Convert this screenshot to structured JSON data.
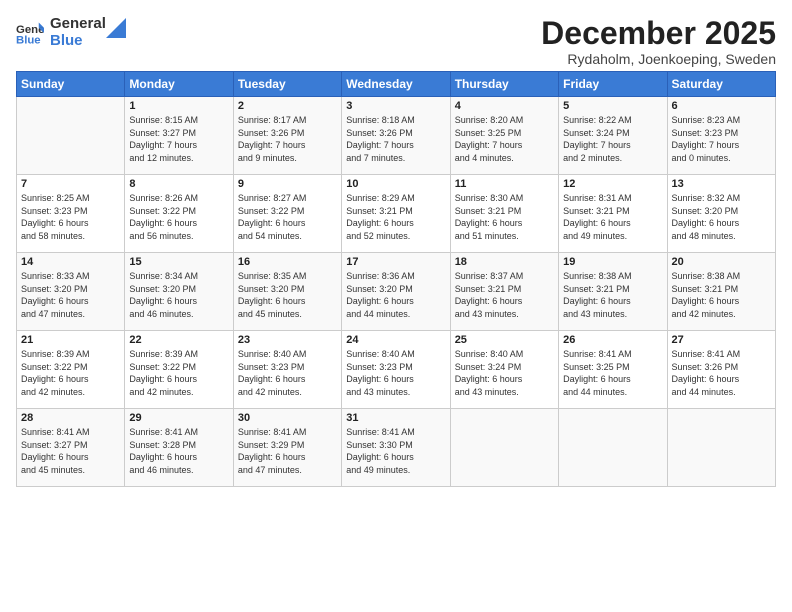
{
  "logo": {
    "general": "General",
    "blue": "Blue"
  },
  "title": "December 2025",
  "subtitle": "Rydaholm, Joenkoeping, Sweden",
  "days_of_week": [
    "Sunday",
    "Monday",
    "Tuesday",
    "Wednesday",
    "Thursday",
    "Friday",
    "Saturday"
  ],
  "weeks": [
    [
      {
        "day": "",
        "content": ""
      },
      {
        "day": "1",
        "content": "Sunrise: 8:15 AM\nSunset: 3:27 PM\nDaylight: 7 hours\nand 12 minutes."
      },
      {
        "day": "2",
        "content": "Sunrise: 8:17 AM\nSunset: 3:26 PM\nDaylight: 7 hours\nand 9 minutes."
      },
      {
        "day": "3",
        "content": "Sunrise: 8:18 AM\nSunset: 3:26 PM\nDaylight: 7 hours\nand 7 minutes."
      },
      {
        "day": "4",
        "content": "Sunrise: 8:20 AM\nSunset: 3:25 PM\nDaylight: 7 hours\nand 4 minutes."
      },
      {
        "day": "5",
        "content": "Sunrise: 8:22 AM\nSunset: 3:24 PM\nDaylight: 7 hours\nand 2 minutes."
      },
      {
        "day": "6",
        "content": "Sunrise: 8:23 AM\nSunset: 3:23 PM\nDaylight: 7 hours\nand 0 minutes."
      }
    ],
    [
      {
        "day": "7",
        "content": "Sunrise: 8:25 AM\nSunset: 3:23 PM\nDaylight: 6 hours\nand 58 minutes."
      },
      {
        "day": "8",
        "content": "Sunrise: 8:26 AM\nSunset: 3:22 PM\nDaylight: 6 hours\nand 56 minutes."
      },
      {
        "day": "9",
        "content": "Sunrise: 8:27 AM\nSunset: 3:22 PM\nDaylight: 6 hours\nand 54 minutes."
      },
      {
        "day": "10",
        "content": "Sunrise: 8:29 AM\nSunset: 3:21 PM\nDaylight: 6 hours\nand 52 minutes."
      },
      {
        "day": "11",
        "content": "Sunrise: 8:30 AM\nSunset: 3:21 PM\nDaylight: 6 hours\nand 51 minutes."
      },
      {
        "day": "12",
        "content": "Sunrise: 8:31 AM\nSunset: 3:21 PM\nDaylight: 6 hours\nand 49 minutes."
      },
      {
        "day": "13",
        "content": "Sunrise: 8:32 AM\nSunset: 3:20 PM\nDaylight: 6 hours\nand 48 minutes."
      }
    ],
    [
      {
        "day": "14",
        "content": "Sunrise: 8:33 AM\nSunset: 3:20 PM\nDaylight: 6 hours\nand 47 minutes."
      },
      {
        "day": "15",
        "content": "Sunrise: 8:34 AM\nSunset: 3:20 PM\nDaylight: 6 hours\nand 46 minutes."
      },
      {
        "day": "16",
        "content": "Sunrise: 8:35 AM\nSunset: 3:20 PM\nDaylight: 6 hours\nand 45 minutes."
      },
      {
        "day": "17",
        "content": "Sunrise: 8:36 AM\nSunset: 3:20 PM\nDaylight: 6 hours\nand 44 minutes."
      },
      {
        "day": "18",
        "content": "Sunrise: 8:37 AM\nSunset: 3:21 PM\nDaylight: 6 hours\nand 43 minutes."
      },
      {
        "day": "19",
        "content": "Sunrise: 8:38 AM\nSunset: 3:21 PM\nDaylight: 6 hours\nand 43 minutes."
      },
      {
        "day": "20",
        "content": "Sunrise: 8:38 AM\nSunset: 3:21 PM\nDaylight: 6 hours\nand 42 minutes."
      }
    ],
    [
      {
        "day": "21",
        "content": "Sunrise: 8:39 AM\nSunset: 3:22 PM\nDaylight: 6 hours\nand 42 minutes."
      },
      {
        "day": "22",
        "content": "Sunrise: 8:39 AM\nSunset: 3:22 PM\nDaylight: 6 hours\nand 42 minutes."
      },
      {
        "day": "23",
        "content": "Sunrise: 8:40 AM\nSunset: 3:23 PM\nDaylight: 6 hours\nand 42 minutes."
      },
      {
        "day": "24",
        "content": "Sunrise: 8:40 AM\nSunset: 3:23 PM\nDaylight: 6 hours\nand 43 minutes."
      },
      {
        "day": "25",
        "content": "Sunrise: 8:40 AM\nSunset: 3:24 PM\nDaylight: 6 hours\nand 43 minutes."
      },
      {
        "day": "26",
        "content": "Sunrise: 8:41 AM\nSunset: 3:25 PM\nDaylight: 6 hours\nand 44 minutes."
      },
      {
        "day": "27",
        "content": "Sunrise: 8:41 AM\nSunset: 3:26 PM\nDaylight: 6 hours\nand 44 minutes."
      }
    ],
    [
      {
        "day": "28",
        "content": "Sunrise: 8:41 AM\nSunset: 3:27 PM\nDaylight: 6 hours\nand 45 minutes."
      },
      {
        "day": "29",
        "content": "Sunrise: 8:41 AM\nSunset: 3:28 PM\nDaylight: 6 hours\nand 46 minutes."
      },
      {
        "day": "30",
        "content": "Sunrise: 8:41 AM\nSunset: 3:29 PM\nDaylight: 6 hours\nand 47 minutes."
      },
      {
        "day": "31",
        "content": "Sunrise: 8:41 AM\nSunset: 3:30 PM\nDaylight: 6 hours\nand 49 minutes."
      },
      {
        "day": "",
        "content": ""
      },
      {
        "day": "",
        "content": ""
      },
      {
        "day": "",
        "content": ""
      }
    ]
  ]
}
